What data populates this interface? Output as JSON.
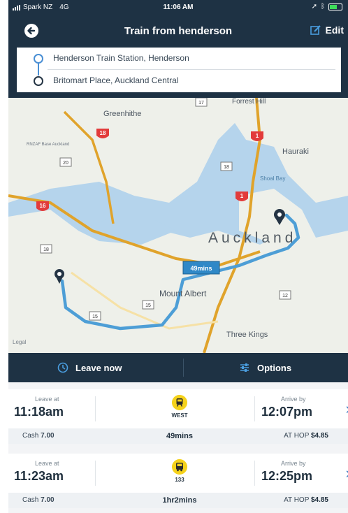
{
  "status_bar": {
    "carrier": "Spark NZ",
    "network": "4G",
    "time": "11:06 AM"
  },
  "header": {
    "title": "Train from henderson",
    "edit_label": "Edit"
  },
  "route": {
    "from": "Henderson Train Station, Henderson",
    "to": "Britomart Place, Auckland Central"
  },
  "map": {
    "labels": {
      "city": "Auckland",
      "greenhithe": "Greenhithe",
      "hauraki": "Hauraki",
      "mount_albert": "Mount Albert",
      "three_kings": "Three Kings",
      "forrest_hill": "Forrest Hill",
      "shoal_bay": "Shoal Bay",
      "rnzaf": "RNZAF Base Auckland",
      "legal": "Legal"
    },
    "duration_badge": "49mins",
    "road_shields": [
      "18",
      "1",
      "1",
      "16",
      "20",
      "17",
      "18",
      "18",
      "12",
      "15",
      "15"
    ],
    "colors": {
      "water": "#b5d4ec",
      "land": "#eef0ea",
      "route": "#4d9ed6",
      "motorway": "#e0a32b"
    }
  },
  "actions": {
    "leave_now": "Leave now",
    "options": "Options"
  },
  "trips": [
    {
      "leave_label": "Leave at",
      "leave_time": "11:18am",
      "mode_label": "WEST",
      "mode_icon": "train-icon",
      "arrive_label": "Arrive by",
      "arrive_time": "12:07pm",
      "cash_label": "Cash",
      "cash_value": "7.00",
      "duration": "49mins",
      "hop_label": "AT HOP",
      "hop_value": "$4.85"
    },
    {
      "leave_label": "Leave at",
      "leave_time": "11:23am",
      "mode_label": "133",
      "mode_icon": "bus-icon",
      "arrive_label": "Arrive by",
      "arrive_time": "12:25pm",
      "cash_label": "Cash",
      "cash_value": "7.00",
      "duration": "1hr2mins",
      "hop_label": "AT HOP",
      "hop_value": "$4.85"
    }
  ]
}
